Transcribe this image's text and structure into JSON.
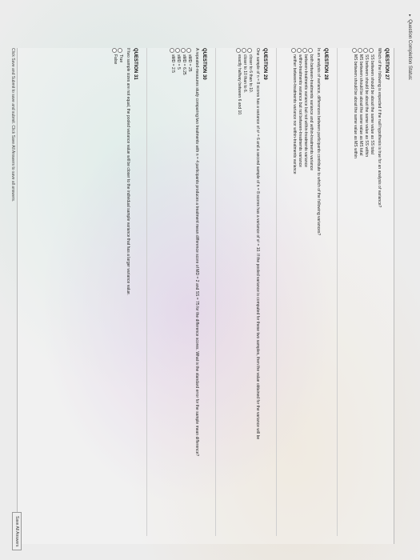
{
  "status_label": "Question Completion Status:",
  "questions": [
    {
      "title": "QUESTION 27",
      "prompt": "Which of the following is expected if the null hypothesis is true for an analysis of variance?",
      "options": [
        "SS between should be about the same value as SS total",
        "SS between should be about the same value as SS within",
        "MS between should be about the same value as MS total",
        "MS between should be about the same value as MS within"
      ]
    },
    {
      "title": "QUESTION 28",
      "prompt": "In an analysis of variance, differences between participants contribute to which of the following variances?",
      "options": [
        "both between-treatments variance and within-treatments variance",
        "between-treatments variance but not within-treatments variance",
        "within-treatments variance but not between-treatments variance",
        "neither between-treatments variance nor within-treatments variance"
      ]
    },
    {
      "title": "QUESTION 29",
      "prompt": "One sample of n = 8 scores has a variance of s² = 6 and a second sample of n = 8 scores has a variance of s² = 10. If the pooled variance is computed for these two samples, then the value obtained for the variance will be",
      "options": [
        "closer to 6 than to 10.",
        "closer to 10 than to 6.",
        "exactly halfway between 6 and 10."
      ]
    },
    {
      "title": "QUESTION 30",
      "prompt": "A repeated-measures study comparing two treatments with n = 4 participants produces a treatment mean difference score of MD = 2 and SS = 75 for the difference scores. What is the standard error for the sample mean difference?",
      "options": [
        "sMD = 25",
        "sMD = 6.25",
        "sMD = 5",
        "sMD = 2.5"
      ]
    },
    {
      "title": "QUESTION 31",
      "prompt": "If two sample sizes are not equal, the pooled variance value will be closer to the individual sample variance that has a larger variance value.",
      "options": [
        "True",
        "False"
      ]
    }
  ],
  "footer_text": "Click Save and Submit to save and submit. Click Save All Answers to save all answers.",
  "save_all_label": "Save All Answers"
}
